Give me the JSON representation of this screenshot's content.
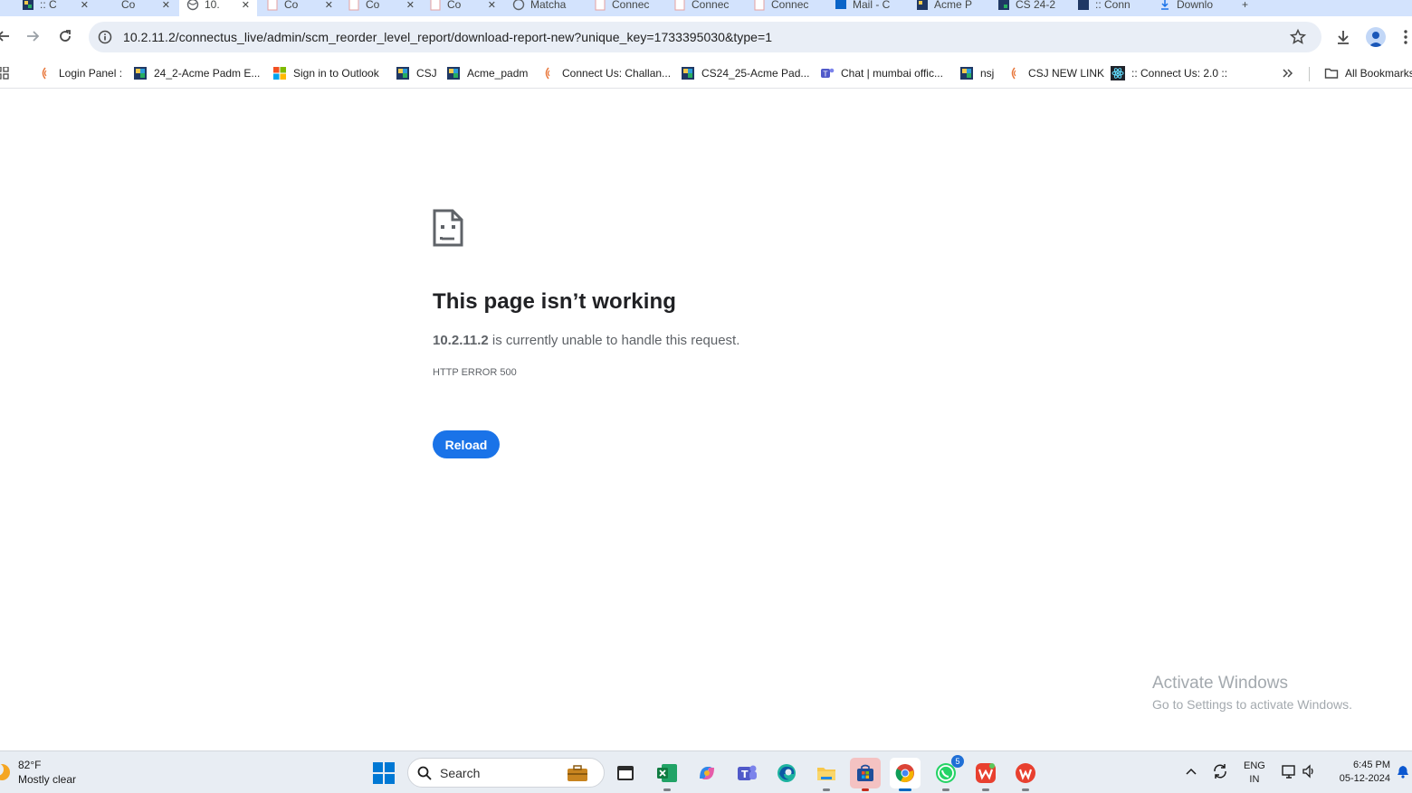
{
  "tabs": [
    {
      "title": ":: C",
      "favicon": "colorful-grid-icon"
    },
    {
      "title": "Co",
      "favicon": "blank-page-icon"
    },
    {
      "title": "10.",
      "favicon": "globe-icon",
      "active": true
    },
    {
      "title": "Co",
      "favicon": "pdf-page-icon"
    },
    {
      "title": "Co",
      "favicon": "pdf-page-icon"
    },
    {
      "title": "Co",
      "favicon": "pdf-page-icon"
    },
    {
      "title": "Matcha",
      "favicon": "globe-icon"
    },
    {
      "title": "Connec",
      "favicon": "pdf-page-icon"
    },
    {
      "title": "Connec",
      "favicon": "pdf-page-icon"
    },
    {
      "title": "Connec",
      "favicon": "pdf-page-icon"
    },
    {
      "title": "Mail - C",
      "favicon": "outlook-icon"
    },
    {
      "title": "Acme P",
      "favicon": "colorful-grid-icon"
    },
    {
      "title": "CS 24-2",
      "favicon": "colorful-grid-icon"
    },
    {
      "title": ":: Conn",
      "favicon": "colorful-grid-icon"
    },
    {
      "title": "Downlo",
      "favicon": "download-icon"
    }
  ],
  "toolbar": {
    "url": "10.2.11.2/connectus_live/admin/scm_reorder_level_report/download-report-new?unique_key=1733395030&type=1"
  },
  "bookmarks": [
    {
      "label": "Login Panel :",
      "icon": "connect-logo-icon"
    },
    {
      "label": "24_2-Acme Padm E...",
      "icon": "colorful-grid-icon"
    },
    {
      "label": "Sign in to Outlook",
      "icon": "microsoft-icon"
    },
    {
      "label": "CSJ",
      "icon": "colorful-grid-icon"
    },
    {
      "label": "Acme_padm",
      "icon": "colorful-grid-icon"
    },
    {
      "label": "Connect Us: Challan...",
      "icon": "connect-logo-icon"
    },
    {
      "label": "CS24_25-Acme Pad...",
      "icon": "colorful-grid-icon"
    },
    {
      "label": "Chat | mumbai offic...",
      "icon": "teams-icon"
    },
    {
      "label": "nsj",
      "icon": "colorful-grid-icon"
    },
    {
      "label": "CSJ NEW LINK",
      "icon": "connect-logo-icon"
    },
    {
      "label": ":: Connect Us: 2.0 ::",
      "icon": "react-icon"
    }
  ],
  "all_bookmarks_label": "All Bookmarks",
  "error_page": {
    "title": "This page isn’t working",
    "host": "10.2.11.2",
    "message": " is currently unable to handle this request.",
    "code": "HTTP ERROR 500",
    "reload_label": "Reload"
  },
  "watermark": {
    "line1": "Activate Windows",
    "line2": "Go to Settings to activate Windows."
  },
  "taskbar": {
    "weather_temp": "82°F",
    "weather_desc": "Mostly clear",
    "search_label": "Search",
    "apps": [
      {
        "name": "briefcase-icon"
      },
      {
        "name": "terminal-icon"
      },
      {
        "name": "excel-icon"
      },
      {
        "name": "copilot-icon"
      },
      {
        "name": "teams-icon"
      },
      {
        "name": "edge-icon"
      },
      {
        "name": "file-explorer-icon"
      },
      {
        "name": "microsoft-store-icon"
      },
      {
        "name": "chrome-icon"
      },
      {
        "name": "whatsapp-icon",
        "badge": "5"
      },
      {
        "name": "wps-icon"
      },
      {
        "name": "wps-office-icon"
      }
    ],
    "lang_line1": "ENG",
    "lang_line2": "IN",
    "time": "6:45 PM",
    "date": "05-12-2024"
  }
}
